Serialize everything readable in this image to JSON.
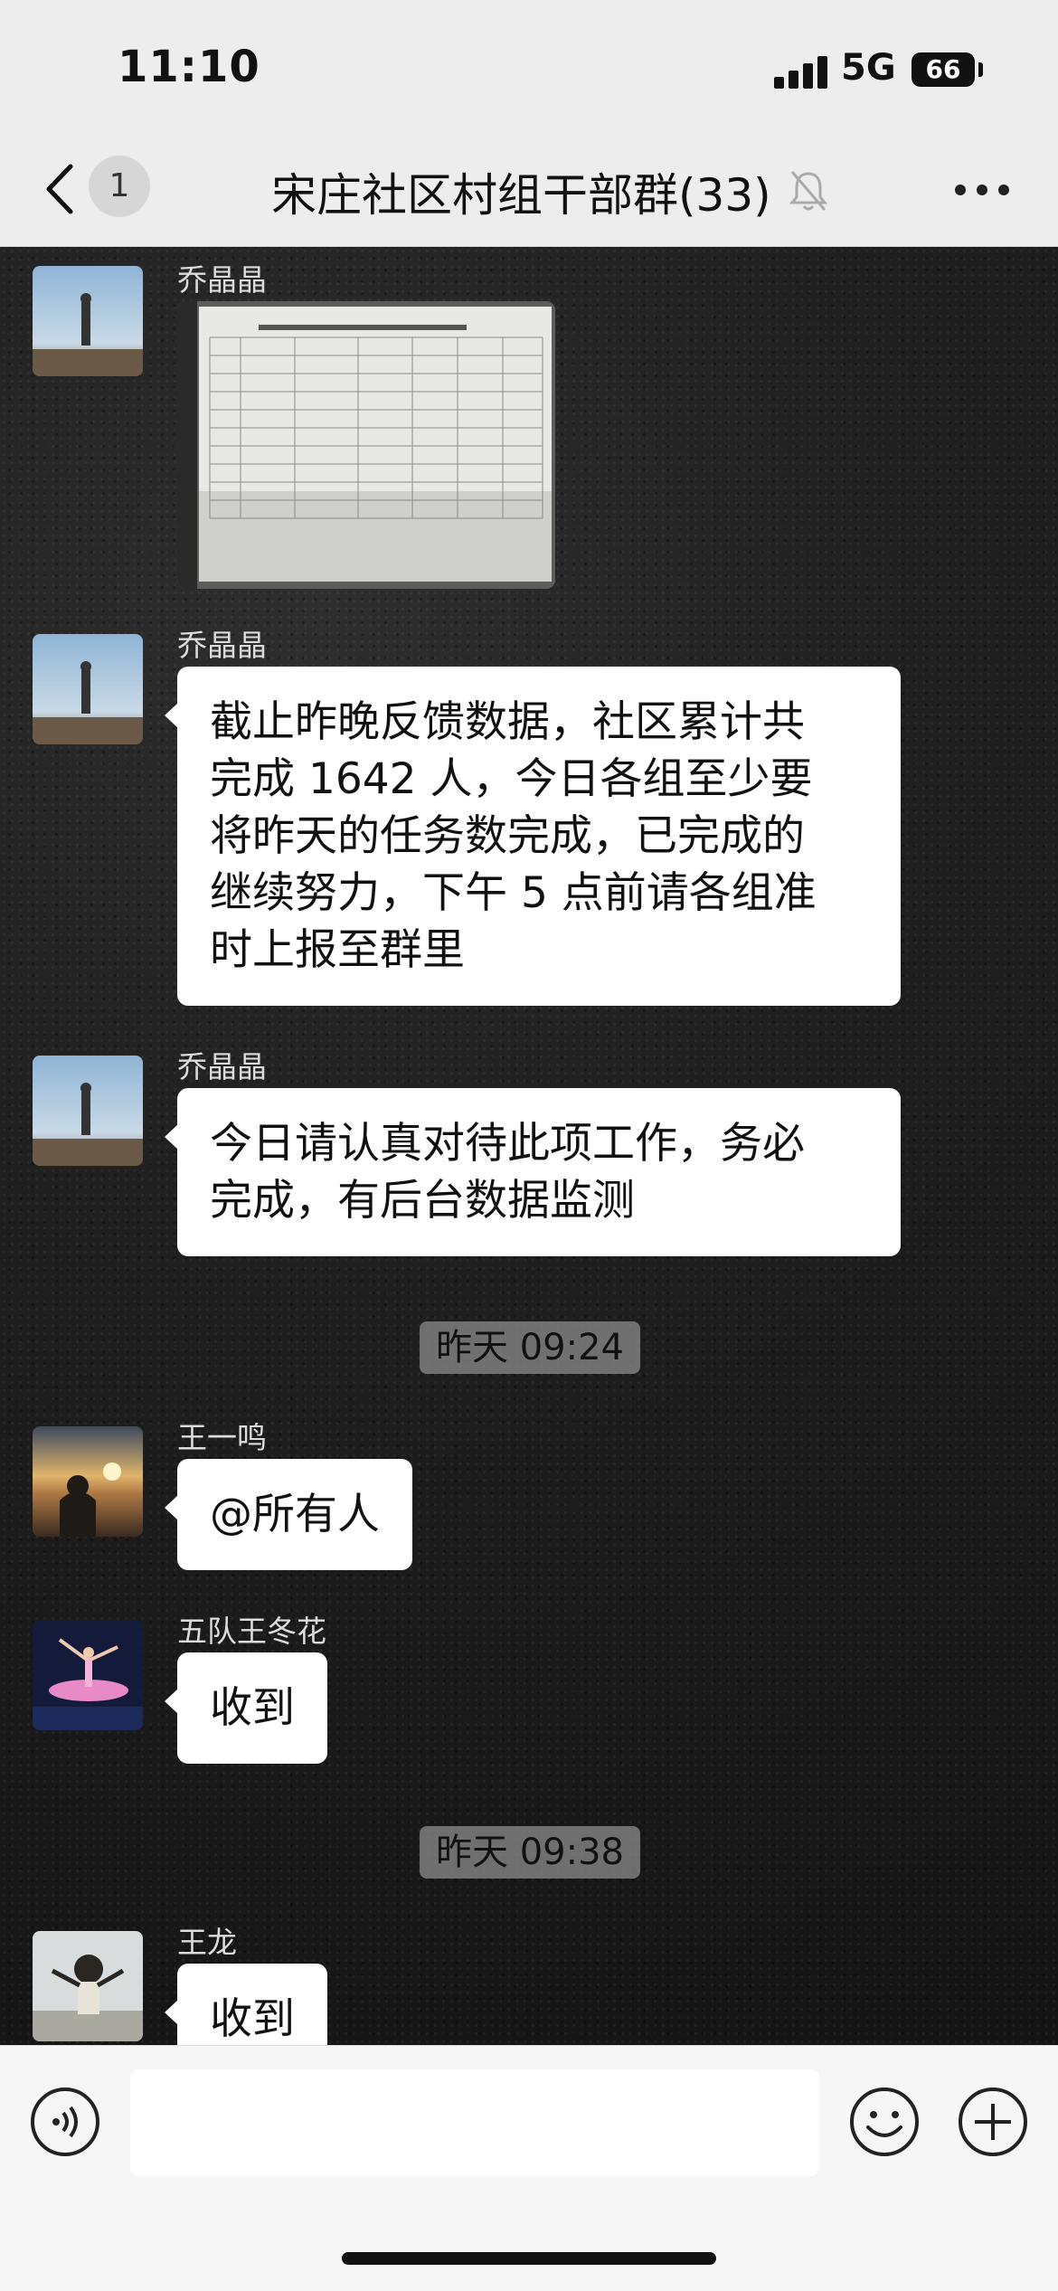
{
  "status_bar": {
    "time": "11:10",
    "network": "5G",
    "battery": "66"
  },
  "nav": {
    "back_icon": "chevron-left-icon",
    "unread_count": "1",
    "title": "宋庄社区村组干部群(33)",
    "mute_icon": "bell-muted-icon",
    "more_icon": "more-dots-icon"
  },
  "messages": [
    {
      "sender": "乔晶晶",
      "type": "image",
      "avatar": "woman-by-sea"
    },
    {
      "sender": "乔晶晶",
      "type": "text",
      "avatar": "woman-by-sea",
      "lines": [
        "截止昨晚反馈数据，社区累计共",
        "完成 1642 人，今日各组至少要",
        "将昨天的任务数完成，已完成的",
        "继续努力，下午 5 点前请各组准",
        "时上报至群里"
      ]
    },
    {
      "sender": "乔晶晶",
      "type": "text",
      "avatar": "woman-by-sea",
      "lines": [
        "今日请认真对待此项工作，务必",
        "完成，有后台数据监测"
      ]
    },
    {
      "type": "time",
      "text": "昨天 09:24"
    },
    {
      "sender": "王一鸣",
      "type": "text",
      "avatar": "sunset-person",
      "lines": [
        "@所有人"
      ]
    },
    {
      "sender": "五队王冬花",
      "type": "text",
      "avatar": "ballet-dancer",
      "lines": [
        "收到"
      ]
    },
    {
      "type": "time",
      "text": "昨天 09:38"
    },
    {
      "sender": "王龙",
      "type": "text",
      "avatar": "person-arms-raised",
      "lines": [
        "收到"
      ]
    }
  ],
  "input_bar": {
    "voice_icon": "voice-icon",
    "input_value": "",
    "emoji_icon": "emoji-icon",
    "plus_icon": "plus-icon"
  },
  "colors": {
    "nav_bg": "#ededed",
    "bubble": "#ffffff",
    "chat_bg": "#1c1c1c"
  }
}
